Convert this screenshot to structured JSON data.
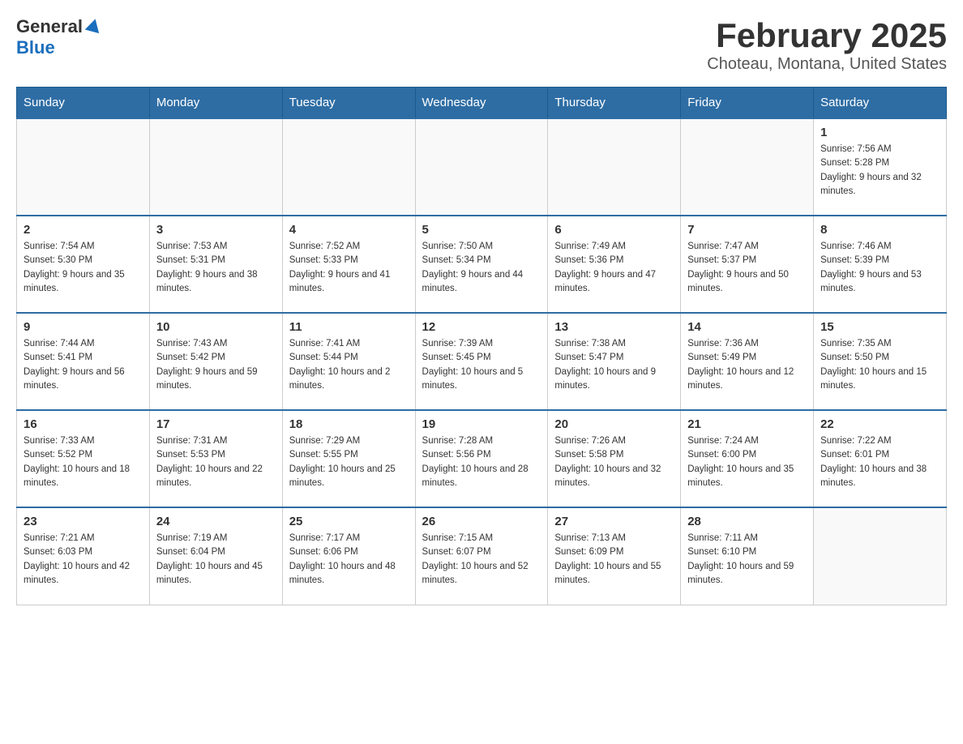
{
  "logo": {
    "general": "General",
    "blue": "Blue"
  },
  "title": "February 2025",
  "location": "Choteau, Montana, United States",
  "days_of_week": [
    "Sunday",
    "Monday",
    "Tuesday",
    "Wednesday",
    "Thursday",
    "Friday",
    "Saturday"
  ],
  "weeks": [
    [
      {
        "day": "",
        "info": ""
      },
      {
        "day": "",
        "info": ""
      },
      {
        "day": "",
        "info": ""
      },
      {
        "day": "",
        "info": ""
      },
      {
        "day": "",
        "info": ""
      },
      {
        "day": "",
        "info": ""
      },
      {
        "day": "1",
        "info": "Sunrise: 7:56 AM\nSunset: 5:28 PM\nDaylight: 9 hours and 32 minutes."
      }
    ],
    [
      {
        "day": "2",
        "info": "Sunrise: 7:54 AM\nSunset: 5:30 PM\nDaylight: 9 hours and 35 minutes."
      },
      {
        "day": "3",
        "info": "Sunrise: 7:53 AM\nSunset: 5:31 PM\nDaylight: 9 hours and 38 minutes."
      },
      {
        "day": "4",
        "info": "Sunrise: 7:52 AM\nSunset: 5:33 PM\nDaylight: 9 hours and 41 minutes."
      },
      {
        "day": "5",
        "info": "Sunrise: 7:50 AM\nSunset: 5:34 PM\nDaylight: 9 hours and 44 minutes."
      },
      {
        "day": "6",
        "info": "Sunrise: 7:49 AM\nSunset: 5:36 PM\nDaylight: 9 hours and 47 minutes."
      },
      {
        "day": "7",
        "info": "Sunrise: 7:47 AM\nSunset: 5:37 PM\nDaylight: 9 hours and 50 minutes."
      },
      {
        "day": "8",
        "info": "Sunrise: 7:46 AM\nSunset: 5:39 PM\nDaylight: 9 hours and 53 minutes."
      }
    ],
    [
      {
        "day": "9",
        "info": "Sunrise: 7:44 AM\nSunset: 5:41 PM\nDaylight: 9 hours and 56 minutes."
      },
      {
        "day": "10",
        "info": "Sunrise: 7:43 AM\nSunset: 5:42 PM\nDaylight: 9 hours and 59 minutes."
      },
      {
        "day": "11",
        "info": "Sunrise: 7:41 AM\nSunset: 5:44 PM\nDaylight: 10 hours and 2 minutes."
      },
      {
        "day": "12",
        "info": "Sunrise: 7:39 AM\nSunset: 5:45 PM\nDaylight: 10 hours and 5 minutes."
      },
      {
        "day": "13",
        "info": "Sunrise: 7:38 AM\nSunset: 5:47 PM\nDaylight: 10 hours and 9 minutes."
      },
      {
        "day": "14",
        "info": "Sunrise: 7:36 AM\nSunset: 5:49 PM\nDaylight: 10 hours and 12 minutes."
      },
      {
        "day": "15",
        "info": "Sunrise: 7:35 AM\nSunset: 5:50 PM\nDaylight: 10 hours and 15 minutes."
      }
    ],
    [
      {
        "day": "16",
        "info": "Sunrise: 7:33 AM\nSunset: 5:52 PM\nDaylight: 10 hours and 18 minutes."
      },
      {
        "day": "17",
        "info": "Sunrise: 7:31 AM\nSunset: 5:53 PM\nDaylight: 10 hours and 22 minutes."
      },
      {
        "day": "18",
        "info": "Sunrise: 7:29 AM\nSunset: 5:55 PM\nDaylight: 10 hours and 25 minutes."
      },
      {
        "day": "19",
        "info": "Sunrise: 7:28 AM\nSunset: 5:56 PM\nDaylight: 10 hours and 28 minutes."
      },
      {
        "day": "20",
        "info": "Sunrise: 7:26 AM\nSunset: 5:58 PM\nDaylight: 10 hours and 32 minutes."
      },
      {
        "day": "21",
        "info": "Sunrise: 7:24 AM\nSunset: 6:00 PM\nDaylight: 10 hours and 35 minutes."
      },
      {
        "day": "22",
        "info": "Sunrise: 7:22 AM\nSunset: 6:01 PM\nDaylight: 10 hours and 38 minutes."
      }
    ],
    [
      {
        "day": "23",
        "info": "Sunrise: 7:21 AM\nSunset: 6:03 PM\nDaylight: 10 hours and 42 minutes."
      },
      {
        "day": "24",
        "info": "Sunrise: 7:19 AM\nSunset: 6:04 PM\nDaylight: 10 hours and 45 minutes."
      },
      {
        "day": "25",
        "info": "Sunrise: 7:17 AM\nSunset: 6:06 PM\nDaylight: 10 hours and 48 minutes."
      },
      {
        "day": "26",
        "info": "Sunrise: 7:15 AM\nSunset: 6:07 PM\nDaylight: 10 hours and 52 minutes."
      },
      {
        "day": "27",
        "info": "Sunrise: 7:13 AM\nSunset: 6:09 PM\nDaylight: 10 hours and 55 minutes."
      },
      {
        "day": "28",
        "info": "Sunrise: 7:11 AM\nSunset: 6:10 PM\nDaylight: 10 hours and 59 minutes."
      },
      {
        "day": "",
        "info": ""
      }
    ]
  ]
}
